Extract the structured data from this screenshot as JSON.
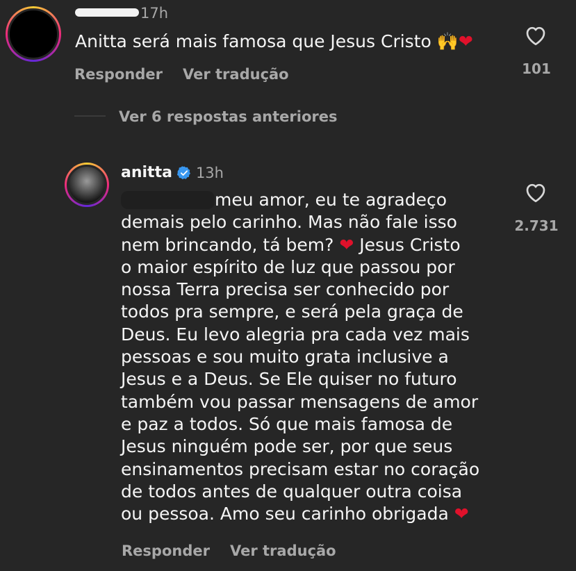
{
  "comment1": {
    "time": "17h",
    "text": "Anitta será mais famosa que Jesus Cristo",
    "emoji_hands": "🙌",
    "emoji_heart": "❤",
    "reply_label": "Responder",
    "translate_label": "Ver tradução",
    "like_count": "101",
    "icon": "heart-outline-icon"
  },
  "replies_toggle": {
    "label": "Ver 6 respostas anteriores"
  },
  "comment2": {
    "username": "anitta",
    "time": "13h",
    "text_lines": [
      "meu amor, eu te agradeço",
      "demais pelo carinho. Mas não fale isso",
      "nem brincando, tá bem?",
      "Jesus Cristo",
      "o maior espírito de luz que passou por",
      "nossa Terra precisa ser conhecido por",
      "todos pra sempre, e será pela graça de",
      "Deus. Eu levo alegria pra cada vez mais",
      "pessoas e sou muito grata inclusive a",
      "Jesus e a Deus. Se Ele quiser no futuro",
      "também vou passar mensagens de amor",
      "e paz a todos. Só que mais famosa de",
      "Jesus ninguém pode ser, por que seus",
      "ensinamentos precisam estar no coração",
      "de todos antes de qualquer outra coisa",
      "ou pessoa. Amo seu carinho obrigada"
    ],
    "emoji_heart": "❤",
    "reply_label": "Responder",
    "translate_label": "Ver tradução",
    "like_count": "2.731",
    "verified_icon": "verified-badge-icon",
    "icon": "heart-outline-icon"
  },
  "colors": {
    "background": "#262626",
    "text": "#f5f5f5",
    "muted": "#a8a8a8",
    "verified": "#3897f0",
    "heart": "#e0112b"
  }
}
